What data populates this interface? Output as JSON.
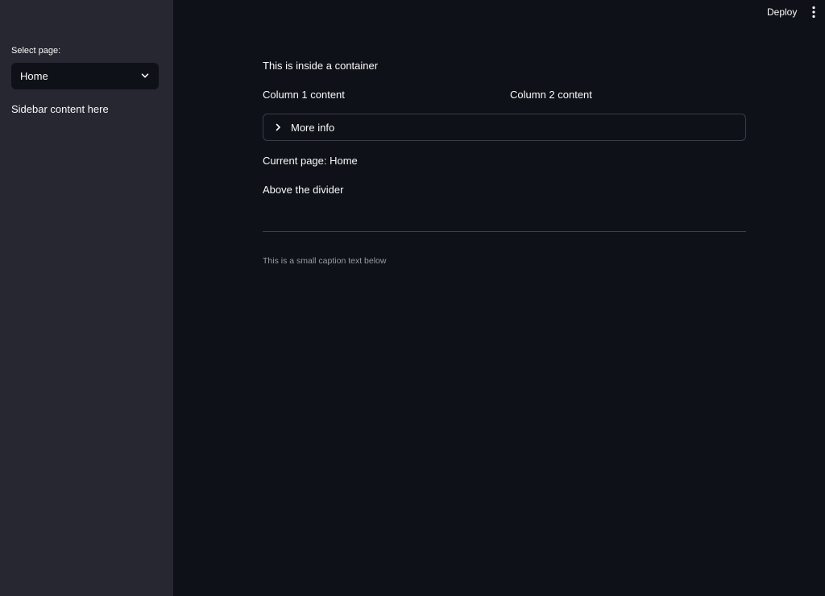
{
  "sidebar": {
    "select_label": "Select page:",
    "select_value": "Home",
    "text": "Sidebar content here"
  },
  "topbar": {
    "deploy_label": "Deploy",
    "menu_icon": "vertical-ellipsis-icon"
  },
  "main": {
    "container_text": "This is inside a container",
    "column1": "Column 1 content",
    "column2": "Column 2 content",
    "expander_label": "More info",
    "current_page": "Current page: Home",
    "above_divider": "Above the divider",
    "caption": "This is a small caption text below"
  },
  "colors": {
    "background": "#0e1117",
    "sidebar": "#262730",
    "text": "#fafafa",
    "caption": "#9a9ca4",
    "border": "#3a3d48"
  }
}
